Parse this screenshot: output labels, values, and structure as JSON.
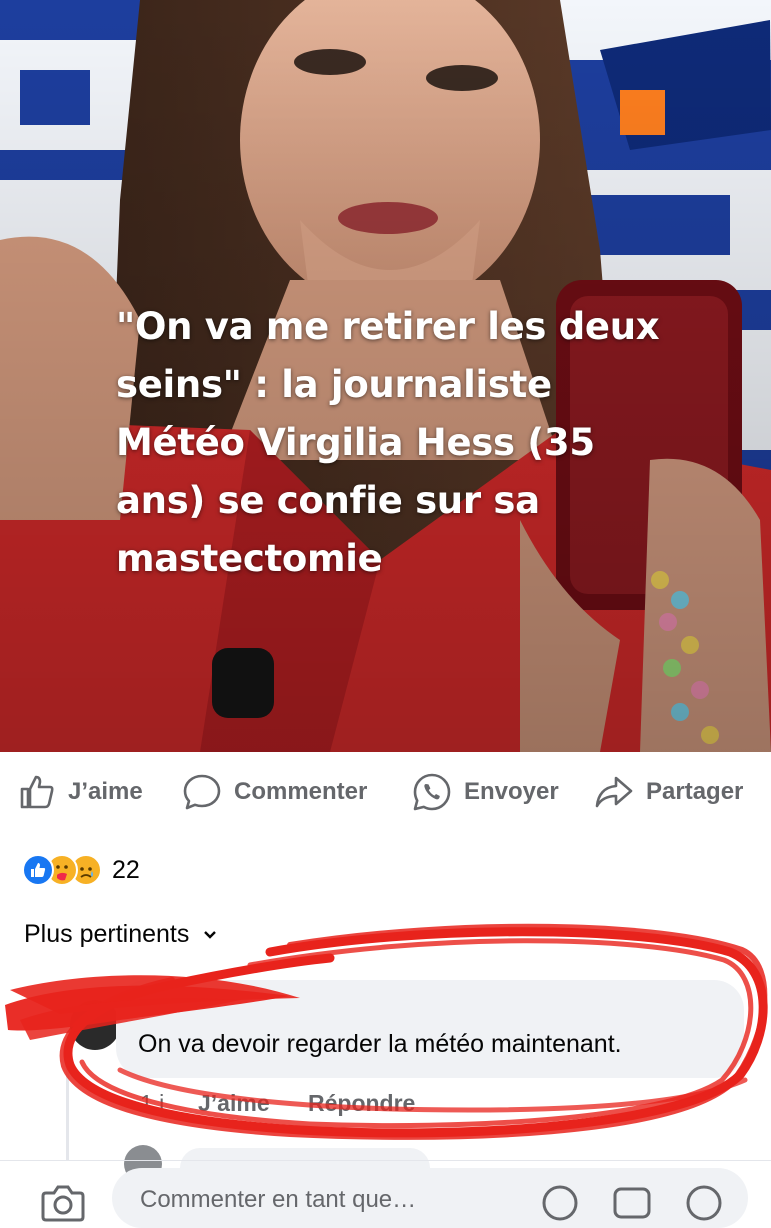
{
  "post": {
    "headline": "\"On va me retirer les deux seins\" : la journaliste Météo Virgilia Hess (35 ans) se confie sur sa mastectomie"
  },
  "actions": {
    "like": "J’aime",
    "comment": "Commenter",
    "send": "Envoyer",
    "share": "Partager"
  },
  "reactions": {
    "icons": [
      "like-icon",
      "care-icon",
      "sad-icon"
    ],
    "count": "22"
  },
  "comments": {
    "sort_label": "Plus pertinents",
    "items": [
      {
        "text": "On va devoir regarder la météo maintenant.",
        "time": "1 j",
        "like_label": "J’aime",
        "reply_label": "Répondre"
      }
    ]
  },
  "composer": {
    "placeholder": "Commenter en tant que…"
  },
  "colors": {
    "facebook_blue": "#1877f2",
    "secondary_text": "#65676b",
    "bubble": "#f0f2f5",
    "scribble_red": "#e8231c"
  }
}
